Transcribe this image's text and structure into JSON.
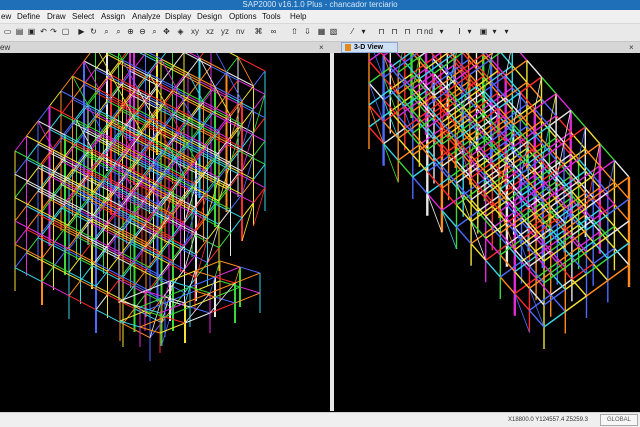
{
  "window": {
    "title": "SAP2000 v16.1.0 Plus  - chancador terciario"
  },
  "menu": {
    "items": [
      {
        "label": "ew"
      },
      {
        "label": "Define"
      },
      {
        "label": "Draw"
      },
      {
        "label": "Select"
      },
      {
        "label": "Assign"
      },
      {
        "label": "Analyze"
      },
      {
        "label": "Display"
      },
      {
        "label": "Design"
      },
      {
        "label": "Options"
      },
      {
        "label": "Tools"
      },
      {
        "label": "Help"
      }
    ]
  },
  "toolbar": {
    "view_labels": {
      "xy": "xy",
      "xz": "xz",
      "yz": "yz",
      "nv": "nv"
    },
    "nd_label": "nd"
  },
  "panes": {
    "left": {
      "tab_label": "ew",
      "close_symbol": "×"
    },
    "right": {
      "tab_label": "3-D View",
      "close_symbol": "×"
    }
  },
  "status": {
    "coords": "X18800.0  Y124557.4  Z5259.3",
    "coord_system": "GLOBAL"
  },
  "colors": {
    "titlebar": "#1e6fb8",
    "viewport_bg": "#000000",
    "frame_white": "#e8e8e8",
    "frame_yellow": "#f2e233",
    "frame_magenta": "#e02ad8",
    "frame_cyan": "#35d6e6",
    "frame_green": "#38d838",
    "frame_orange": "#ff8a1c",
    "frame_red": "#ff2b2b",
    "frame_blue": "#4b6bff"
  }
}
